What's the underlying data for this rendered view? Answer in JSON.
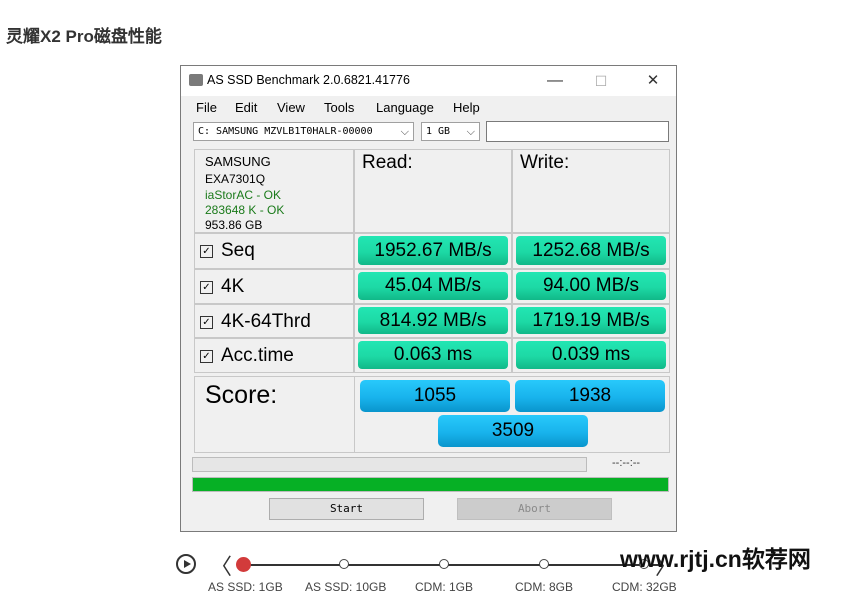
{
  "page_title": "灵耀X2 Pro磁盘性能",
  "window": {
    "title": "AS SSD Benchmark 2.0.6821.41776",
    "controls": {
      "minimize": "—",
      "maximize": "☐",
      "close": "✕"
    }
  },
  "menu": [
    "File",
    "Edit",
    "View",
    "Tools",
    "Language",
    "Help"
  ],
  "drive_select": {
    "value": "C: SAMSUNG MZVLB1T0HALR-00000"
  },
  "size_select": {
    "value": "1 GB"
  },
  "text_input": {
    "value": ""
  },
  "drive_info": {
    "vendor": "SAMSUNG",
    "firmware": "EXA7301Q",
    "driver": "iaStorAC - OK",
    "alignment": "283648 K - OK",
    "capacity": "953.86 GB",
    "ok_color": "#1a7a1a"
  },
  "headers": {
    "read": "Read:",
    "write": "Write:"
  },
  "tests": [
    {
      "label": "Seq",
      "checked": true,
      "read": "1952.67 MB/s",
      "write": "1252.68 MB/s"
    },
    {
      "label": "4K",
      "checked": true,
      "read": "45.04 MB/s",
      "write": "94.00 MB/s"
    },
    {
      "label": "4K-64Thrd",
      "checked": true,
      "read": "814.92 MB/s",
      "write": "1719.19 MB/s"
    },
    {
      "label": "Acc.time",
      "checked": true,
      "read": "0.063 ms",
      "write": "0.039 ms"
    }
  ],
  "checkbox_glyph": "✓",
  "score": {
    "label": "Score:",
    "read": "1055",
    "write": "1938",
    "total": "3509"
  },
  "progress": {
    "time": "--:--:--",
    "value": 0
  },
  "status_bar": {
    "value": 1.0,
    "color": "#06b025"
  },
  "buttons": {
    "start": "Start",
    "abort": "Abort"
  },
  "colors": {
    "result_green": "#1dd9a5",
    "score_blue": "#18b3ec"
  },
  "carousel": {
    "steps": [
      "AS SSD: 1GB",
      "AS SSD: 10GB",
      "CDM: 1GB",
      "CDM: 8GB",
      "CDM: 32GB"
    ],
    "active_index": 0,
    "prev_glyph": "〈",
    "next_glyph": "〉"
  },
  "watermark": "www.rjtj.cn软荐网"
}
